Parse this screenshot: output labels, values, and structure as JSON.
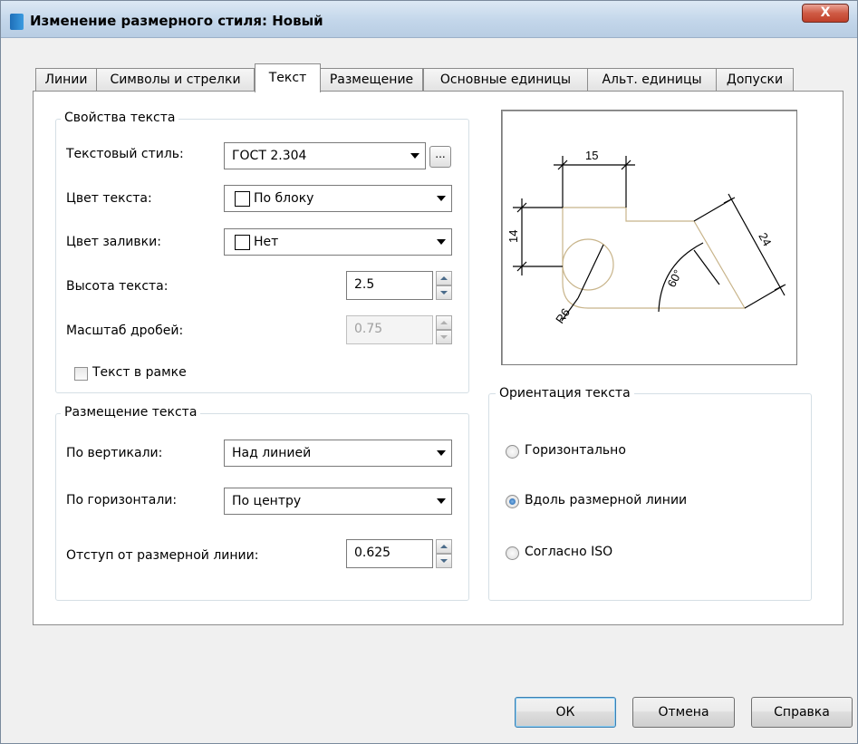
{
  "window": {
    "title": "Изменение размерного стиля: Новый",
    "close_label": "X"
  },
  "tabs": [
    {
      "label": "Линии",
      "active": false
    },
    {
      "label": "Символы и стрелки",
      "active": false
    },
    {
      "label": "Текст",
      "active": true
    },
    {
      "label": "Размещение",
      "active": false
    },
    {
      "label": "Основные единицы",
      "active": false
    },
    {
      "label": "Альт. единицы",
      "active": false
    },
    {
      "label": "Допуски",
      "active": false
    }
  ],
  "text_properties": {
    "title": "Свойства текста",
    "text_style_label": "Текстовый стиль:",
    "text_style_value": "ГОСТ 2.304",
    "browse_label": "...",
    "text_color_label": "Цвет текста:",
    "text_color_value": "По блоку",
    "fill_color_label": "Цвет заливки:",
    "fill_color_value": "Нет",
    "text_height_label": "Высота текста:",
    "text_height_value": "2.5",
    "fraction_scale_label": "Масштаб дробей:",
    "fraction_scale_value": "0.75",
    "frame_label": "Текст в рамке",
    "frame_checked": false
  },
  "text_placement": {
    "title": "Размещение текста",
    "vertical_label": "По вертикали:",
    "vertical_value": "Над линией",
    "horizontal_label": "По горизонтали:",
    "horizontal_value": "По центру",
    "offset_label": "Отступ от размерной линии:",
    "offset_value": "0.625"
  },
  "text_orientation": {
    "title": "Ориентация текста",
    "options": [
      {
        "label": "Горизонтально",
        "checked": false
      },
      {
        "label": "Вдоль размерной линии",
        "checked": true
      },
      {
        "label": "Согласно ISO",
        "checked": false
      }
    ]
  },
  "preview": {
    "dim_top": "15",
    "dim_left": "14",
    "dim_right": "24",
    "dim_angle": "60°",
    "dim_radius": "R6",
    "part_color": "#c8b48a"
  },
  "buttons": {
    "ok": "ОК",
    "cancel": "Отмена",
    "help": "Справка"
  }
}
